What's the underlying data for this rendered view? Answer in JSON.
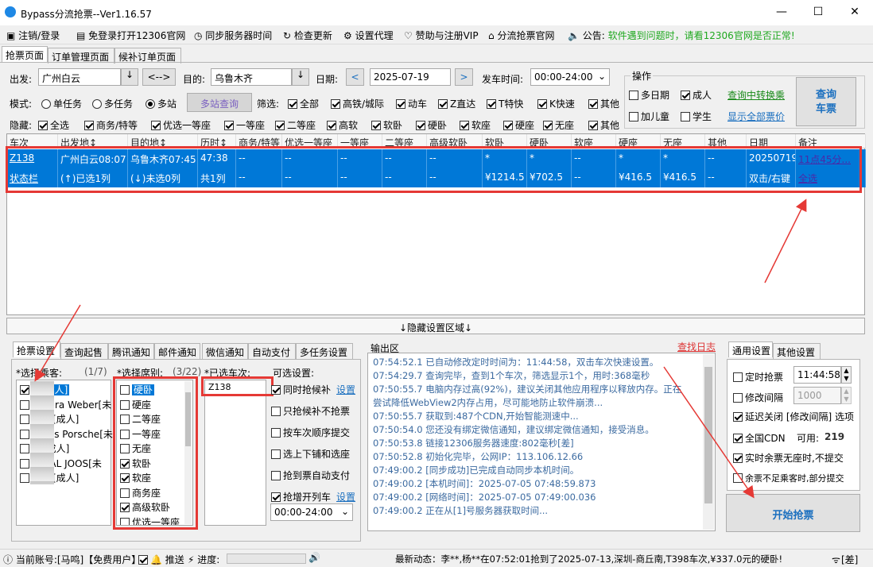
{
  "window": {
    "title": "Bypass分流抢票--Ver1.16.57",
    "min": "—",
    "max": "☐",
    "close": "✕"
  },
  "menu": {
    "login": "注销/登录",
    "open12306": "免登录打开12306官网",
    "sync": "同步服务器时间",
    "update": "检查更新",
    "proxy": "设置代理",
    "vip": "赞助与注册VIP",
    "site": "分流抢票官网",
    "notice_label": "公告:",
    "notice": "软件遇到问题时，请看12306官网是否正常!"
  },
  "tabs": [
    "抢票页面",
    "订单管理页面",
    "候补订单页面"
  ],
  "search": {
    "from_label": "出发:",
    "from": "广州白云",
    "swap": "<-->",
    "to_label": "目的:",
    "to": "乌鲁木齐",
    "date_label": "日期:",
    "prev": "<",
    "date": "2025-07-19",
    "next": ">",
    "time_label": "发车时间:",
    "time": "00:00-24:00",
    "mode_label": "模式:",
    "modes": [
      "单任务",
      "多任务",
      "多站"
    ],
    "mode_selected": 2,
    "multi_query": "多站查询",
    "filter_label": "筛选:",
    "filters": [
      {
        "t": "全部",
        "c": true
      },
      {
        "t": "高铁/城际",
        "c": true
      },
      {
        "t": "动车",
        "c": true
      },
      {
        "t": "Z直达",
        "c": true
      },
      {
        "t": "T特快",
        "c": true
      },
      {
        "t": "K快速",
        "c": true
      },
      {
        "t": "其他",
        "c": true
      }
    ],
    "hide_label": "隐藏:",
    "hides": [
      {
        "t": "全选",
        "c": true
      },
      {
        "t": "商务/特等",
        "c": true
      },
      {
        "t": "优选一等座",
        "c": true
      },
      {
        "t": "一等座",
        "c": true
      },
      {
        "t": "二等座",
        "c": true
      },
      {
        "t": "高软",
        "c": true
      },
      {
        "t": "软卧",
        "c": true
      },
      {
        "t": "硬卧",
        "c": true
      },
      {
        "t": "软座",
        "c": true
      },
      {
        "t": "硬座",
        "c": true
      },
      {
        "t": "无座",
        "c": true
      },
      {
        "t": "其他",
        "c": true
      }
    ]
  },
  "ops": {
    "title": "操作",
    "multi_date": "多日期",
    "adult": "成人",
    "child": "加儿童",
    "student": "学生",
    "transfer": "查询中转换乘",
    "show_all": "显示全部票价",
    "query1": "查询",
    "query2": "车票"
  },
  "grid": {
    "headers": [
      "车次",
      "出发地↕",
      "目的地↕",
      "历时↕",
      "商务/特等",
      "优选一等座",
      "一等座",
      "二等座",
      "高级软卧",
      "软卧",
      "硬卧",
      "软座",
      "硬座",
      "无座",
      "其他",
      "日期",
      "备注"
    ],
    "row1": [
      "Z138",
      "广州白云08:07",
      "乌鲁木齐07:45",
      "47:38",
      "--",
      "--",
      "--",
      "--",
      "--",
      "*",
      "*",
      "--",
      "*",
      "*",
      "--",
      "20250719",
      "11点45分..."
    ],
    "row2": [
      "状态栏",
      "(↑)已选1列",
      "(↓)未选0列",
      "共1列",
      "--",
      "--",
      "--",
      "--",
      "--",
      "¥1214.5",
      "¥702.5",
      "--",
      "¥416.5",
      "¥416.5",
      "--",
      "双击/右键",
      "全选"
    ]
  },
  "hidden_area": "↓隐藏设置区域↓",
  "btabs": [
    "抢票设置",
    "查询起售",
    "腾讯通知",
    "邮件通知",
    "微信通知",
    "自动支付",
    "多任务设置"
  ],
  "passengers": {
    "label": "*选择乘客:",
    "count": "(1/7)",
    "items": [
      {
        "t": "[成人]",
        "c": true
      },
      {
        "t": "bara Weber[未",
        "c": false
      },
      {
        "t": "哲[成人]",
        "c": false
      },
      {
        "t": "cus Porsche[未",
        "c": false
      },
      {
        "t": "[成人]",
        "c": false
      },
      {
        "t": "CAL JOOS[未",
        "c": false
      },
      {
        "t": "玮[成人]",
        "c": false
      }
    ]
  },
  "seats": {
    "label": "*选择席别:",
    "count": "(3/22)",
    "items": [
      {
        "t": "硬卧",
        "c": false
      },
      {
        "t": "硬座",
        "c": false
      },
      {
        "t": "二等座",
        "c": false
      },
      {
        "t": "一等座",
        "c": false
      },
      {
        "t": "无座",
        "c": false
      },
      {
        "t": "软卧",
        "c": true
      },
      {
        "t": "软座",
        "c": true
      },
      {
        "t": "商务座",
        "c": false
      },
      {
        "t": "高级软卧",
        "c": true
      },
      {
        "t": "优选一等座",
        "c": false
      }
    ]
  },
  "trains": {
    "label": "*已选车次:",
    "items": [
      "Z138"
    ]
  },
  "options": {
    "label": "可选设置:",
    "items": [
      {
        "t": "同时抢候补",
        "c": true,
        "link": "设置"
      },
      {
        "t": "只抢候补不抢票",
        "c": false
      },
      {
        "t": "按车次顺序提交",
        "c": false
      },
      {
        "t": "选上下铺和选座",
        "c": false
      },
      {
        "t": "抢到票自动支付",
        "c": false
      },
      {
        "t": "抢增开列车",
        "c": true,
        "link": "设置"
      }
    ],
    "time": "00:00-24:00"
  },
  "output": {
    "label": "输出区",
    "find_log": "查找日志",
    "lines": [
      "07:54:52.1  已自动修改定时时间为：11:44:58，双击车次快速设置。",
      "07:54:29.7  查询完毕，查到1个车次，筛选显示1个，用时:368毫秒",
      "07:50:55.7  电脑内存过高(92%)，建议关闭其他应用程序以释放内存。正在",
      "尝试降低WebView2内存占用，尽可能地防止软件崩溃...",
      "07:50:55.7  获取到:487个CDN,开始智能测速中...",
      "07:50:54.0  您还没有绑定微信通知，建议绑定微信通知，接受消息。",
      "07:50:53.8  链接12306服务器速度:802毫秒[差]",
      "07:50:52.8  初始化完毕，公网IP：113.106.12.66",
      "07:49:00.2  [同步成功]已完成自动同步本机时间。",
      "07:49:00.2  [本机时间]：2025-07-05 07:48:59.873",
      "07:49:00.2  [网络时间]：2025-07-05 07:49:00.036",
      "07:49:00.2  正在从[1]号服务器获取时间..."
    ]
  },
  "rtabs": [
    "通用设置",
    "其他设置"
  ],
  "general": {
    "timer": "定时抢票",
    "timer_val": "11:44:58",
    "interval": "修改间隔",
    "interval_val": "1000",
    "delay": "延迟关闭 [修改间隔] 选项",
    "cdn": "全国CDN",
    "cdn_avail": "可用:",
    "cdn_count": "219",
    "realtime": "实时余票无座时,不提交",
    "partial": "余票不足乘客时,部分提交",
    "start": "开始抢票"
  },
  "status": {
    "account": "当前账号:[马鸣]【免费用户】",
    "push": "推送",
    "progress": "进度:",
    "news": "最新动态：李**,杨**在07:52:01抢到了2025-07-13,深圳-商丘南,T398车次,¥337.0元的硬卧!",
    "net": "[差]"
  },
  "colors": {
    "selection": "#0078d7",
    "annot": "#e53935",
    "link": "#1a6fbf",
    "notice": "#1fa81f",
    "log": "#3b6aa0"
  }
}
